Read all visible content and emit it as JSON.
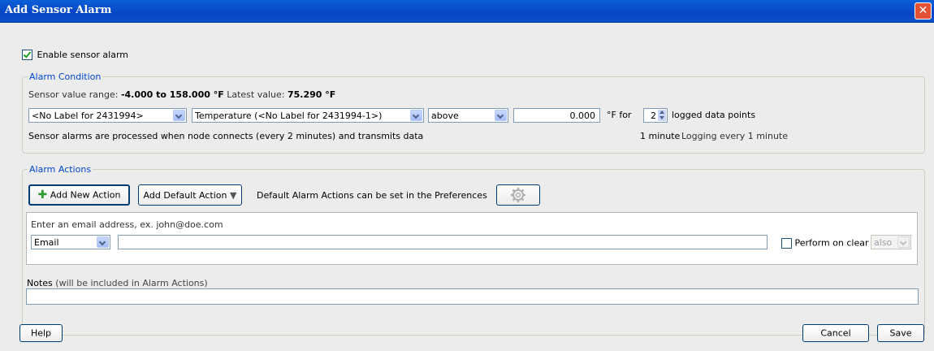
{
  "window": {
    "title": "Add Sensor Alarm",
    "close_glyph": "✕"
  },
  "enable": {
    "label": "Enable sensor alarm",
    "checked": true
  },
  "condition": {
    "legend": "Alarm Condition",
    "range_label": "Sensor value range:",
    "range_value": "-4.000 to 158.000 °F",
    "latest_label": "Latest value:",
    "latest_value": "75.290 °F",
    "node_select": "<No Label for 2431994>",
    "sensor_select": "Temperature (<No Label for 2431994-1>)",
    "comparison_select": "above",
    "threshold_value": "0.000",
    "unit_for": "°F for",
    "points_value": "2",
    "points_label": "logged data points",
    "processing_note": "Sensor alarms are processed when node connects (every 2 minutes) and transmits data",
    "duration": "1 minute",
    "logging": "Logging every 1 minute"
  },
  "actions": {
    "legend": "Alarm Actions",
    "add_new_label": "Add New Action",
    "add_default_label": "Add Default Action",
    "default_note": "Default Alarm Actions can be set in the Preferences",
    "hint": "Enter an email address, ex. john@doe.com",
    "type_select": "Email",
    "email_value": "",
    "perform_on_clear_label": "Perform on clear",
    "perform_on_clear_checked": false,
    "also_select": "also",
    "notes_label": "Notes",
    "notes_sub": "(will be included in Alarm Actions)",
    "notes_value": ""
  },
  "footer": {
    "help_label": "Help",
    "cancel_label": "Cancel",
    "save_label": "Save"
  },
  "icons": {
    "add": "plus-icon",
    "gear": "gear-icon",
    "dropdown": "triangle-down-icon"
  }
}
